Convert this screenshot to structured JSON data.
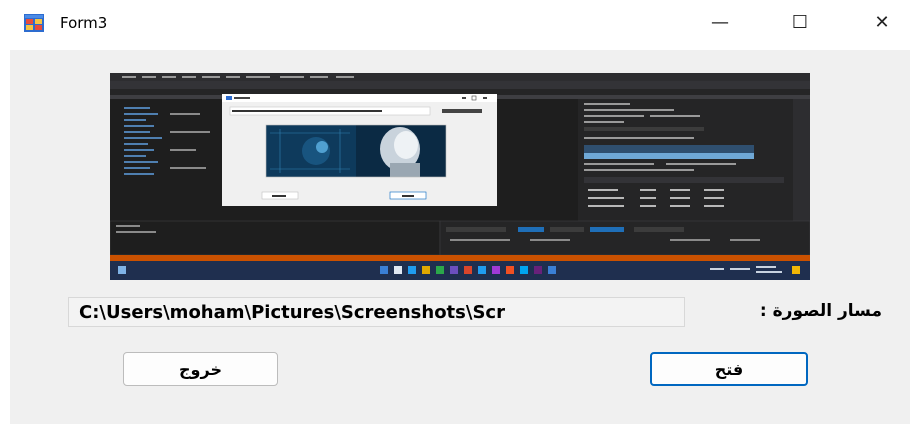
{
  "window": {
    "title": "Form3",
    "minimize_glyph": "—",
    "maximize_glyph": "☐",
    "close_glyph": "✕"
  },
  "path_field": {
    "label": "مسار الصورة :",
    "value": "C:\\Users\\moham\\Pictures\\Screenshots\\Scr"
  },
  "buttons": {
    "exit_label": "خروج",
    "open_label": "فتح"
  },
  "colors": {
    "accent_border": "#0067c0",
    "client_bg": "#f0f0f0",
    "preview_bg": "#1e1e1e"
  }
}
